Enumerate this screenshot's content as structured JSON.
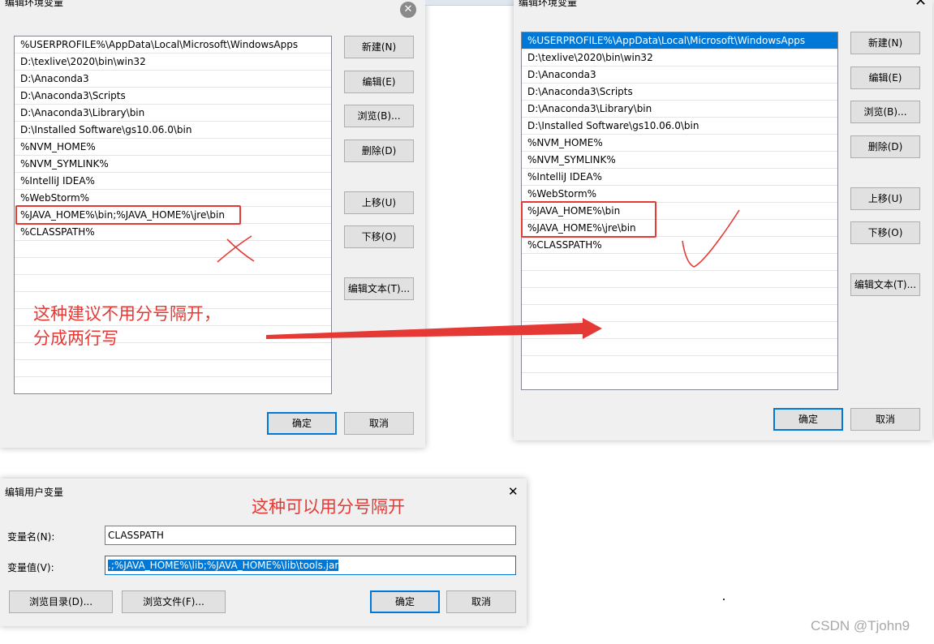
{
  "left_dialog": {
    "title": "编辑环境变量",
    "items": [
      "%USERPROFILE%\\AppData\\Local\\Microsoft\\WindowsApps",
      "D:\\texlive\\2020\\bin\\win32",
      "D:\\Anaconda3",
      "D:\\Anaconda3\\Scripts",
      "D:\\Anaconda3\\Library\\bin",
      "D:\\Installed Software\\gs10.06.0\\bin",
      "%NVM_HOME%",
      "%NVM_SYMLINK%",
      "%IntelliJ IDEA%",
      "%WebStorm%",
      "%JAVA_HOME%\\bin;%JAVA_HOME%\\jre\\bin",
      "%CLASSPATH%"
    ],
    "buttons": {
      "new": "新建(N)",
      "edit": "编辑(E)",
      "browse": "浏览(B)...",
      "delete": "删除(D)",
      "up": "上移(U)",
      "down": "下移(O)",
      "edit_text": "编辑文本(T)...",
      "ok": "确定",
      "cancel": "取消"
    }
  },
  "right_dialog": {
    "title": "编辑环境变量",
    "items": [
      "%USERPROFILE%\\AppData\\Local\\Microsoft\\WindowsApps",
      "D:\\texlive\\2020\\bin\\win32",
      "D:\\Anaconda3",
      "D:\\Anaconda3\\Scripts",
      "D:\\Anaconda3\\Library\\bin",
      "D:\\Installed Software\\gs10.06.0\\bin",
      "%NVM_HOME%",
      "%NVM_SYMLINK%",
      "%IntelliJ IDEA%",
      "%WebStorm%",
      "%JAVA_HOME%\\bin",
      "%JAVA_HOME%\\jre\\bin",
      "%CLASSPATH%"
    ],
    "buttons": {
      "new": "新建(N)",
      "edit": "编辑(E)",
      "browse": "浏览(B)...",
      "delete": "删除(D)",
      "up": "上移(U)",
      "down": "下移(O)",
      "edit_text": "编辑文本(T)...",
      "ok": "确定",
      "cancel": "取消"
    }
  },
  "user_var_dialog": {
    "title": "编辑用户变量",
    "name_label": "变量名(N):",
    "name_value": "CLASSPATH",
    "value_label": "变量值(V):",
    "value_value": ".;%JAVA_HOME%\\lib;%JAVA_HOME%\\lib\\tools.jar",
    "buttons": {
      "browse_dir": "浏览目录(D)...",
      "browse_file": "浏览文件(F)...",
      "ok": "确定",
      "cancel": "取消"
    }
  },
  "annotations": {
    "left_note_line1": "这种建议不用分号隔开，",
    "left_note_line2": "分成两行写",
    "bottom_note": "这种可以用分号隔开",
    "color": "#e53935"
  },
  "watermark": "CSDN @Tjohn9"
}
